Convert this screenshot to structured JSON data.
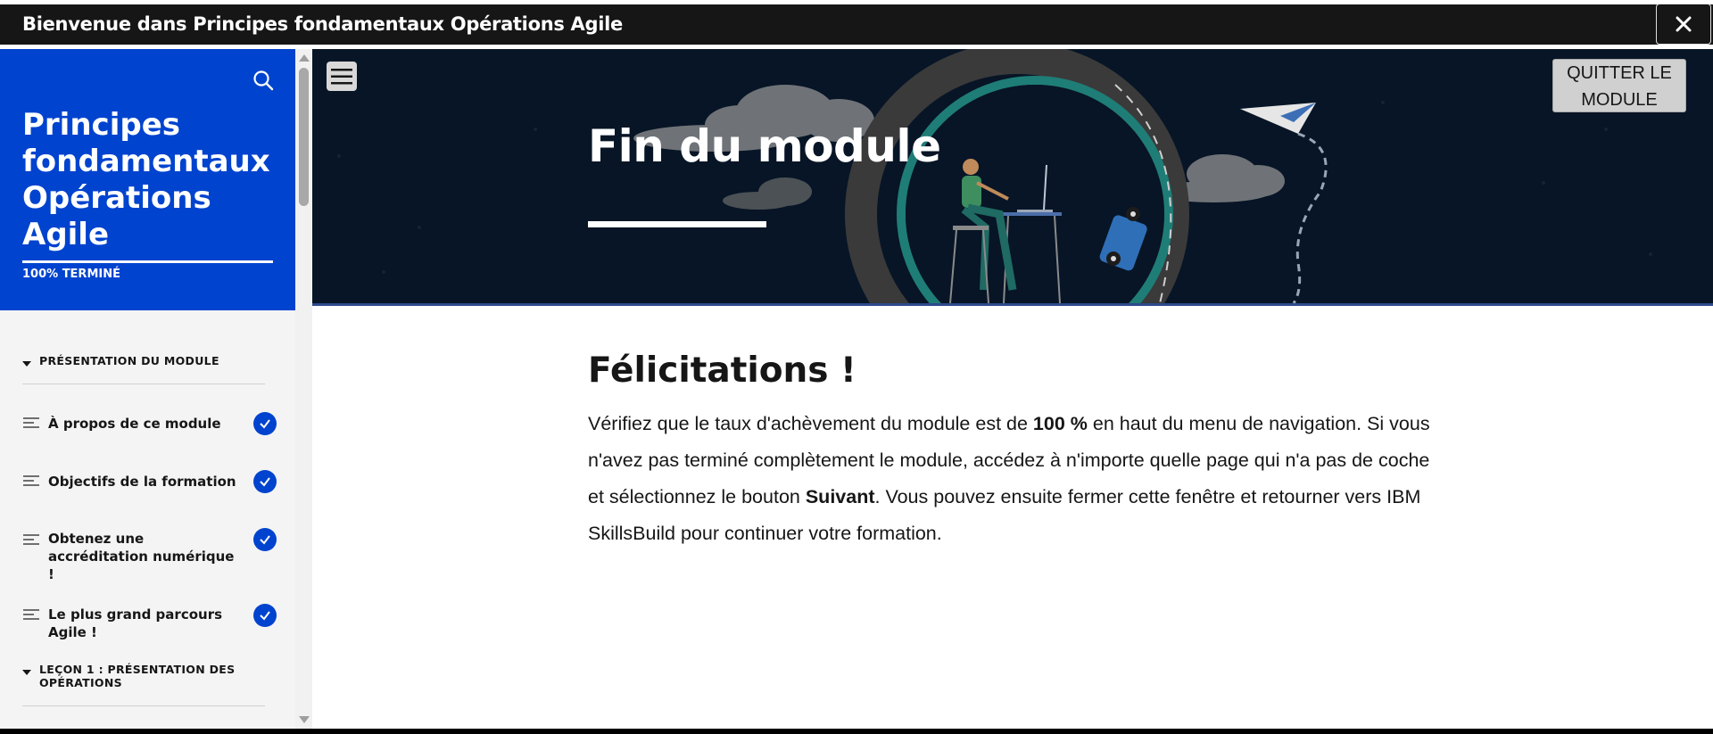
{
  "window": {
    "title": "Bienvenue dans Principes fondamentaux Opérations Agile",
    "close_icon": "close-icon"
  },
  "sidebar": {
    "course_title": "Principes fondamentaux Opérations Agile",
    "progress_label": "100% TERMINÉ",
    "progress_fraction": 1.0,
    "search_icon": "search-icon",
    "sections": [
      {
        "label": "PRÉSENTATION DU MODULE"
      },
      {
        "label": "LEÇON 1 : PRÉSENTATION DES OPÉRATIONS"
      }
    ],
    "items": [
      {
        "label": "À propos de ce module",
        "completed": true
      },
      {
        "label": "Objectifs de la formation",
        "completed": true
      },
      {
        "label": "Obtenez une accréditation numérique !",
        "completed": true
      },
      {
        "label": "Le plus grand parcours Agile !",
        "completed": true
      }
    ]
  },
  "main": {
    "menu_icon": "hamburger-menu-icon",
    "module_title": "Fin du module",
    "quit_button": {
      "line1": "QUITTER LE",
      "line2": "MODULE"
    },
    "congrats_heading": "Félicitations !",
    "body": {
      "p1": "Vérifiez que le taux d'achèvement du module est de ",
      "b1": "100 %",
      "p2": " en haut du menu de navigation. Si vous n'avez pas terminé complètement le module, accédez à n'importe quelle page qui n'a pas de coche et sélectionnez le bouton ",
      "b2": "Suivant",
      "p3": ". Vous pouvez ensuite fermer cette fenêtre et retourner vers IBM SkillsBuild pour continuer votre formation."
    }
  },
  "colors": {
    "sidebar_header": "#0043ce",
    "banner_bg": "#071526",
    "check": "#0043ce",
    "topbar": "#161616"
  }
}
